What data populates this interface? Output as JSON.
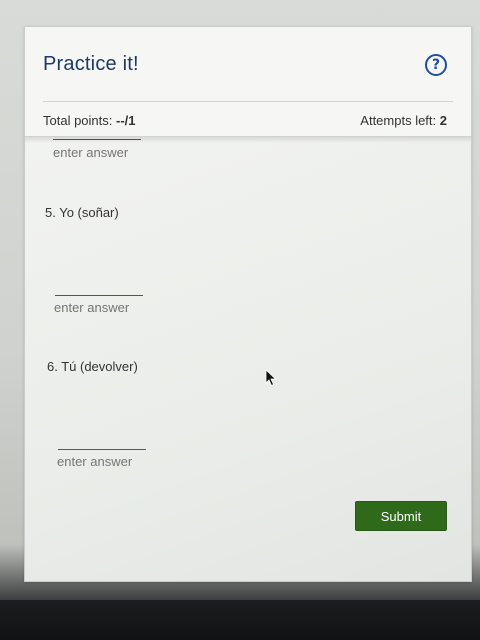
{
  "header": {
    "title": "Practice it!",
    "help_icon": "question-circle-icon",
    "total_points_label": "Total points: ",
    "total_points_value": "--/1",
    "attempts_label": "Attempts left: ",
    "attempts_value": "2"
  },
  "questions": [
    {
      "prompt": "",
      "placeholder": "enter answer"
    },
    {
      "prompt": "5. Yo (soñar)",
      "placeholder": "enter answer"
    },
    {
      "prompt": "6. Tú (devolver)",
      "placeholder": "enter answer"
    }
  ],
  "actions": {
    "submit_label": "Submit"
  },
  "colors": {
    "title": "#1d3a63",
    "help_icon": "#1d4f9c",
    "submit_bg": "#2f6a1b"
  }
}
